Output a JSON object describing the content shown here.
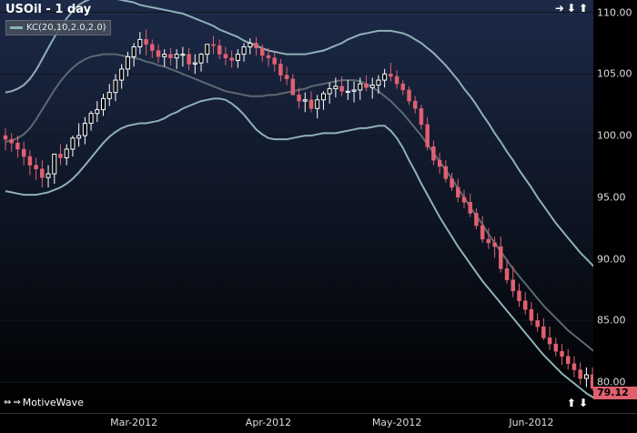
{
  "window": {
    "title": "USOil - 1 day",
    "brand": "MotiveWave"
  },
  "legend": {
    "label": "KC(20,10,2.0,2.0)",
    "color": "#8fb0b8"
  },
  "nav_icons": [
    "arrow-right-icon",
    "arrow-down-icon",
    "arrow-up-icon",
    "arrow-up-icon",
    "arrow-down-icon"
  ],
  "colors": {
    "background_top": "#1c2a48",
    "background_bottom": "#000000",
    "up_candle": "#ffffff",
    "down_candle": "#e06070",
    "band_outer": "#8fb0b8",
    "band_mid": "#5a6a70",
    "grid": "#101622"
  },
  "chart_data": {
    "type": "candlestick",
    "title": "USOil - 1 day",
    "ylim": [
      77.5,
      111.0
    ],
    "y_ticks": [
      "110.00",
      "105.00",
      "100.00",
      "95.00",
      "90.00",
      "85.00",
      "80.00"
    ],
    "y_tick_values": [
      110,
      105,
      100,
      95,
      90,
      85,
      80
    ],
    "x_ticks": [
      "Mar-2012",
      "Apr-2012",
      "May-2012",
      "Jun-2012"
    ],
    "x_tick_bar_index": [
      21,
      43,
      64,
      86
    ],
    "current_price": "79.12",
    "series": [
      {
        "name": "KC(20,10,2.0,2.0)",
        "style": "bands",
        "upper": [
          103.5,
          103.6,
          103.8,
          104.1,
          104.6,
          105.3,
          106.2,
          107.1,
          108,
          108.8,
          109.5,
          110.1,
          110.6,
          110.9,
          111.1,
          111.2,
          111.2,
          111.2,
          111.1,
          111,
          110.9,
          110.8,
          110.6,
          110.5,
          110.4,
          110.3,
          110.2,
          110.1,
          110,
          109.9,
          109.7,
          109.5,
          109.3,
          109.1,
          108.9,
          108.6,
          108.4,
          108.2,
          108,
          107.7,
          107.5,
          107.3,
          107.1,
          106.9,
          106.8,
          106.7,
          106.6,
          106.6,
          106.6,
          106.6,
          106.7,
          106.8,
          106.9,
          107.1,
          107.3,
          107.5,
          107.8,
          108,
          108.2,
          108.3,
          108.4,
          108.5,
          108.5,
          108.5,
          108.4,
          108.3,
          108.1,
          107.8,
          107.5,
          107.1,
          106.7,
          106.2,
          105.7,
          105.1,
          104.5,
          103.8,
          103.2,
          102.5,
          101.7,
          101,
          100.2,
          99.5,
          98.7,
          98,
          97.2,
          96.5,
          95.8,
          95,
          94.3,
          93.6,
          92.9,
          92.3,
          91.7,
          91.1,
          90.5,
          90,
          89.5,
          89
        ],
        "middle": [
          99.5,
          99.6,
          99.8,
          100.1,
          100.6,
          101.3,
          102.1,
          102.9,
          103.7,
          104.4,
          105,
          105.5,
          105.9,
          106.2,
          106.4,
          106.5,
          106.6,
          106.6,
          106.6,
          106.5,
          106.4,
          106.3,
          106.2,
          106,
          105.9,
          105.7,
          105.6,
          105.4,
          105.2,
          105,
          104.8,
          104.6,
          104.4,
          104.2,
          104,
          103.8,
          103.6,
          103.5,
          103.4,
          103.3,
          103.2,
          103.2,
          103.2,
          103.3,
          103.3,
          103.4,
          103.5,
          103.6,
          103.7,
          103.8,
          104,
          104.1,
          104.2,
          104.3,
          104.4,
          104.5,
          104.5,
          104.5,
          104.4,
          104.2,
          103.9,
          103.6,
          103.2,
          102.8,
          102.3,
          101.8,
          101.2,
          100.6,
          100,
          99.3,
          98.6,
          97.9,
          97.2,
          96.5,
          95.7,
          95,
          94.2,
          93.5,
          92.8,
          92,
          91.3,
          90.6,
          89.9,
          89.2,
          88.6,
          88,
          87.4,
          86.8,
          86.2,
          85.7,
          85.2,
          84.7,
          84.2,
          83.8,
          83.4,
          83,
          82.6,
          82.3
        ],
        "lower": [
          95.5,
          95.4,
          95.3,
          95.2,
          95.2,
          95.2,
          95.3,
          95.4,
          95.6,
          95.8,
          96.1,
          96.5,
          97,
          97.6,
          98.2,
          98.8,
          99.4,
          99.9,
          100.3,
          100.6,
          100.8,
          100.9,
          101,
          101,
          101.1,
          101.2,
          101.4,
          101.7,
          101.9,
          102.2,
          102.4,
          102.6,
          102.8,
          102.9,
          103,
          103,
          102.9,
          102.6,
          102.2,
          101.7,
          101.1,
          100.5,
          100.1,
          99.8,
          99.7,
          99.7,
          99.7,
          99.8,
          99.9,
          100,
          100,
          100.1,
          100.2,
          100.2,
          100.2,
          100.3,
          100.4,
          100.5,
          100.6,
          100.6,
          100.7,
          100.8,
          100.8,
          100.4,
          99.8,
          99,
          98,
          97.1,
          96.1,
          95.2,
          94.3,
          93.4,
          92.6,
          91.8,
          91,
          90.3,
          89.6,
          88.9,
          88.2,
          87.6,
          87,
          86.4,
          85.8,
          85.2,
          84.6,
          84,
          83.4,
          82.8,
          82.2,
          81.7,
          81.2,
          80.7,
          80.3,
          79.9,
          79.5,
          79.1,
          78.8,
          78.5
        ]
      },
      {
        "name": "USOil",
        "style": "candles",
        "open": [
          100,
          99.7,
          99.4,
          98.9,
          98.3,
          97.6,
          97.3,
          96.6,
          96.9,
          98.5,
          98.2,
          98.9,
          99.8,
          100,
          101,
          101.8,
          102.1,
          103,
          103.5,
          104.5,
          105.4,
          106.4,
          107.2,
          107.8,
          107.4,
          106.9,
          106.4,
          106.6,
          106.3,
          106.6,
          106.6,
          105.8,
          105.9,
          106.6,
          107.4,
          107.3,
          106.6,
          106.3,
          106.1,
          106.6,
          107.2,
          107.5,
          107.1,
          106.5,
          106.3,
          105.8,
          104.9,
          104.6,
          103.3,
          102.8,
          102.9,
          102.2,
          102.9,
          103.4,
          103.8,
          104,
          103.6,
          103.6,
          103.7,
          104.2,
          103.9,
          104.1,
          104.5,
          105,
          104.8,
          104.2,
          103.7,
          102.8,
          102.2,
          100.9,
          99.1,
          98,
          97.5,
          96.5,
          95.8,
          95,
          94.6,
          93.7,
          92.7,
          91.6,
          91.3,
          91,
          89.2,
          88.3,
          87.4,
          86.6,
          85.9,
          85,
          84.5,
          83.6,
          83.1,
          82.5,
          82.1,
          81.5,
          81,
          80.3,
          80.6,
          79.5
        ],
        "high": [
          100.6,
          100.2,
          100,
          99.5,
          98.8,
          98.2,
          98,
          97.6,
          98.3,
          99.3,
          99.3,
          100,
          101,
          101.5,
          102,
          102.8,
          103.4,
          104.2,
          105,
          105.8,
          106.8,
          107.5,
          108.4,
          108.6,
          107.8,
          107.4,
          107,
          107.1,
          107,
          107.2,
          107.1,
          106.6,
          106.7,
          107.3,
          108.1,
          107.8,
          107.2,
          106.9,
          107,
          107.5,
          107.9,
          108,
          107.4,
          107.1,
          106.8,
          106.2,
          105.6,
          105,
          103.9,
          103.5,
          103.6,
          103.3,
          103.6,
          104.3,
          104.7,
          104.8,
          104.5,
          104.4,
          104.7,
          104.9,
          104.7,
          104.9,
          105.4,
          105.9,
          105.3,
          104.5,
          104,
          103.2,
          102.5,
          101.5,
          99.6,
          98.6,
          98,
          97,
          96.5,
          95.6,
          95.3,
          94.1,
          93.5,
          92.5,
          91.8,
          91.8,
          90,
          89.4,
          88,
          87.3,
          86.5,
          85.6,
          85.2,
          84.5,
          83.6,
          83.1,
          82.7,
          82.1,
          81.6,
          81.2,
          81.2,
          80.3
        ],
        "low": [
          98.8,
          98.7,
          98.2,
          97.6,
          96.8,
          96.4,
          95.8,
          95.8,
          96.1,
          97.6,
          97.6,
          98.3,
          99.1,
          99.3,
          100.4,
          101.1,
          101.6,
          102.4,
          102.8,
          103.8,
          104.8,
          105.6,
          106.6,
          106.5,
          106.3,
          105.9,
          105.6,
          105.7,
          105.4,
          105.6,
          105.3,
          105,
          105.2,
          105.9,
          106.6,
          106.2,
          105.7,
          105.5,
          105.5,
          106,
          106.6,
          106.5,
          106,
          105.6,
          105.2,
          104.4,
          104.1,
          103.6,
          102.2,
          101.9,
          101.9,
          101.4,
          102.1,
          102.6,
          103.1,
          103.2,
          102.9,
          102.7,
          102.9,
          103.6,
          103,
          103.4,
          103.9,
          104.4,
          103.8,
          103.3,
          102.5,
          101.8,
          100.5,
          98.8,
          97.6,
          96.9,
          96.2,
          95.5,
          94.6,
          94.1,
          93.4,
          92.4,
          91.3,
          90.8,
          90.1,
          88.9,
          88,
          86.9,
          86.1,
          85.5,
          84.6,
          84.1,
          83.4,
          82.6,
          82.1,
          81.4,
          81,
          80.4,
          79.8,
          79.6,
          79.3,
          78.1
        ],
        "close": [
          99.7,
          99.4,
          98.9,
          98.3,
          97.6,
          97.3,
          96.6,
          96.9,
          98.5,
          98.2,
          98.9,
          99.8,
          100,
          101,
          101.8,
          102.1,
          103,
          103.5,
          104.5,
          105.4,
          106.4,
          107.2,
          107.8,
          107.4,
          106.9,
          106.4,
          106.6,
          106.3,
          106.6,
          106.6,
          105.8,
          105.9,
          106.6,
          107.4,
          107.3,
          106.6,
          106.3,
          106.1,
          106.6,
          107.2,
          107.5,
          107.1,
          106.5,
          106.3,
          105.8,
          104.9,
          104.6,
          103.3,
          102.8,
          102.9,
          102.2,
          102.9,
          103.4,
          103.8,
          104,
          103.6,
          103.6,
          103.7,
          104.2,
          103.9,
          104.1,
          104.5,
          105,
          104.8,
          104.2,
          103.7,
          102.8,
          102.2,
          100.9,
          99.1,
          98,
          97.5,
          96.5,
          95.8,
          95,
          94.6,
          93.7,
          92.7,
          91.6,
          91.3,
          91,
          89.2,
          88.3,
          87.4,
          86.6,
          85.9,
          85,
          84.5,
          83.6,
          83.1,
          82.5,
          82.1,
          81.5,
          81,
          80.3,
          80.6,
          79.5,
          79.12
        ]
      }
    ]
  }
}
